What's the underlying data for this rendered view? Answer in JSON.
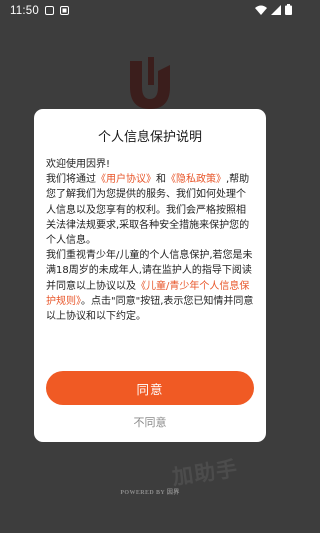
{
  "status_bar": {
    "time": "11:50"
  },
  "dialog": {
    "title": "个人信息保护说明",
    "paragraph_1": "欢迎使用因界!",
    "p2_text_a": "我们将通过",
    "p2_link_user_agreement": "《用户协议》",
    "p2_and": "和",
    "p2_link_privacy_policy": "《隐私政策》",
    "p2_text_b": ",帮助您了解我们为您提供的服务、我们如何处理个人信息以及您享有的权利。我们会严格按照相关法律法规要求,采取各种安全措施来保护您的个人信息。",
    "p3_text_a": "我们重视青少年/儿童的个人信息保护,若您是未满18周岁的未成年人,请在监护人的指导下阅读并同意以上协议以及",
    "p3_link_minors_rules": "《儿童/青少年个人信息保护规则》",
    "p3_text_b": "。点击\"同意\"按钮,表示您已知情并同意以上协议和以下约定。",
    "agree_label": "同意",
    "decline_label": "不同意"
  },
  "footer": {
    "powered_by": "POWERED BY",
    "brand": "因界"
  },
  "watermark": {
    "text": "加助手"
  },
  "colors": {
    "accent": "#f05a24",
    "link": "#e8562a",
    "overlay": "#3d3d3d"
  },
  "icons": {
    "logo": "app-logo-icon",
    "status": [
      "status-app-icon-1",
      "status-app-icon-2",
      "wifi-icon",
      "signal-icon",
      "battery-icon"
    ]
  }
}
